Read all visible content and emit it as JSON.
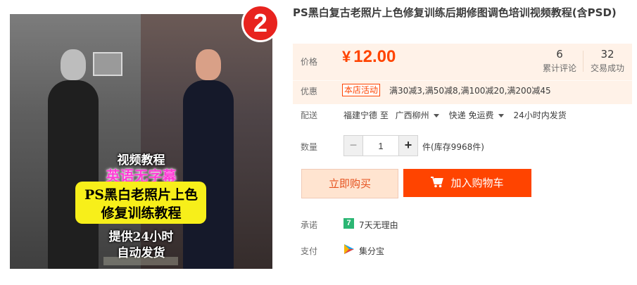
{
  "rank_badge": "2",
  "product": {
    "title": "PS黑白复古老照片上色修复训练后期修图调色培训视频教程(含PSD)",
    "image_text": {
      "line1": "视频教程",
      "line2": "英语无字幕",
      "line3": "PS黑白老照片上色",
      "line4": "修复训练教程",
      "line5": "提供24小时",
      "line6": "自动发货"
    }
  },
  "price": {
    "label": "价格",
    "currency": "¥",
    "amount": "12.00",
    "reviews_count": "6",
    "reviews_label": "累计评论",
    "sold_count": "32",
    "sold_label": "交易成功"
  },
  "promo": {
    "label": "优惠",
    "tag": "本店活动",
    "text": "满30减3,满50减8,满100减20,满200减45"
  },
  "shipping": {
    "label": "配送",
    "from": "福建宁德 至",
    "to": "广西柳州",
    "method": "快递 免运费",
    "dispatch": "24小时内发货"
  },
  "quantity": {
    "label": "数量",
    "minus": "−",
    "plus": "+",
    "value": "1",
    "stock": "件(库存9968件)"
  },
  "buttons": {
    "buy_now": "立即购买",
    "add_to_cart": "加入购物车"
  },
  "promise": {
    "label": "承诺",
    "icon_char": "7",
    "text": "7天无理由"
  },
  "payment": {
    "label": "支付",
    "text": "集分宝"
  },
  "colors": {
    "accent": "#ff4400",
    "price": "#ff4400",
    "promise_green": "#2bb673"
  }
}
